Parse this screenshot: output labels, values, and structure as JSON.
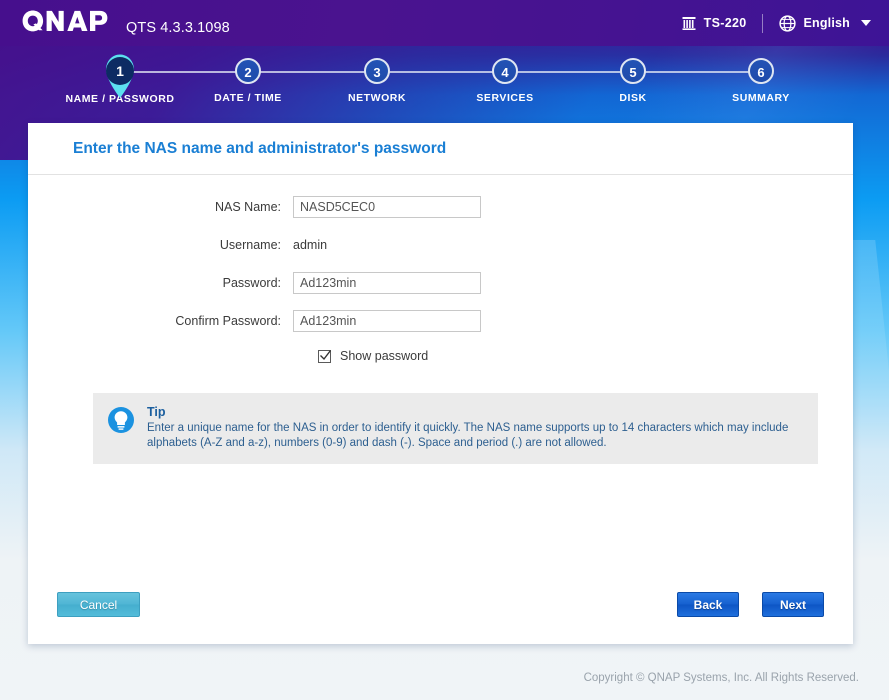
{
  "header": {
    "logo_text": "QNAP",
    "version": "QTS 4.3.3.1098",
    "model": "TS-220",
    "model_icon": "nas-server-icon",
    "language": "English",
    "language_icon": "globe-icon",
    "caret_icon": "chevron-down-icon"
  },
  "stepper": {
    "steps": [
      {
        "number": "1",
        "label": "NAME / PASSWORD",
        "active": true
      },
      {
        "number": "2",
        "label": "DATE / TIME",
        "active": false
      },
      {
        "number": "3",
        "label": "NETWORK",
        "active": false
      },
      {
        "number": "4",
        "label": "SERVICES",
        "active": false
      },
      {
        "number": "5",
        "label": "DISK",
        "active": false
      },
      {
        "number": "6",
        "label": "SUMMARY",
        "active": false
      }
    ]
  },
  "card": {
    "title": "Enter the NAS name and administrator's password"
  },
  "form": {
    "nas_name_label": "NAS Name:",
    "nas_name_value": "NASD5CEC0",
    "username_label": "Username:",
    "username_value": "admin",
    "password_label": "Password:",
    "password_value": "Ad123min",
    "confirm_password_label": "Confirm Password:",
    "confirm_password_value": "Ad123min",
    "show_password_label": "Show password",
    "show_password_checked": true
  },
  "tip": {
    "icon": "lightbulb-icon",
    "title": "Tip",
    "text": "Enter a unique name for the NAS in order to identify it quickly. The NAS name supports up to 14 characters which may include alphabets (A-Z and a-z), numbers (0-9) and dash (-). Space and period (.) are not allowed."
  },
  "buttons": {
    "cancel": "Cancel",
    "back": "Back",
    "next": "Next"
  },
  "footer": {
    "copyright": "Copyright © QNAP Systems, Inc. All Rights Reserved."
  },
  "colors": {
    "header_purple": "#460f8d",
    "accent_blue": "#1a7fd4",
    "button_blue": "#1560cf",
    "cancel_teal": "#4fb5d4",
    "tip_bg": "#ebebeb",
    "active_step": "#0d2b63",
    "pin_cyan": "#5ce0ef"
  }
}
